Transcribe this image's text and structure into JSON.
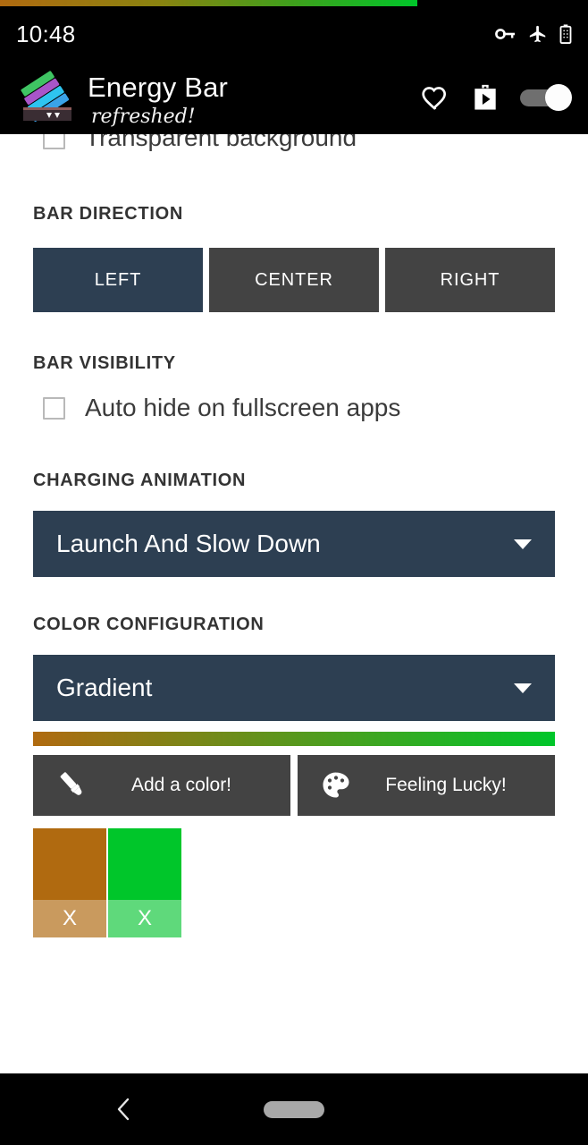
{
  "status_bar": {
    "time": "10:48",
    "icons": [
      "vpn-key-icon",
      "airplane-mode-icon",
      "battery-icon"
    ]
  },
  "app_header": {
    "logo": "energy-bar-logo",
    "title": "Energy Bar",
    "subtitle": "refreshed!",
    "actions": [
      {
        "name": "favorite-icon",
        "label": "heart"
      },
      {
        "name": "play-store-icon",
        "label": "store"
      },
      {
        "name": "master-toggle",
        "label": "on",
        "state": "on"
      }
    ]
  },
  "settings": {
    "transparent_background": {
      "label": "Transparent background",
      "checked": false
    },
    "bar_direction": {
      "title": "BAR DIRECTION",
      "options": [
        "LEFT",
        "CENTER",
        "RIGHT"
      ],
      "selected": "LEFT"
    },
    "bar_visibility": {
      "title": "BAR VISIBILITY",
      "auto_hide_label": "Auto hide on fullscreen apps",
      "auto_hide_checked": false
    },
    "charging_animation": {
      "title": "CHARGING ANIMATION",
      "selected": "Launch And Slow Down"
    },
    "color_configuration": {
      "title": "COLOR CONFIGURATION",
      "selected": "Gradient",
      "gradient_start": "#b06a10",
      "gradient_end": "#00c62a",
      "add_color_label": "Add a color!",
      "feeling_lucky_label": "Feeling Lucky!",
      "swatches": [
        {
          "color": "#b06a10",
          "remove_label": "X",
          "remove_bar_color": "#c99a5e"
        },
        {
          "color": "#00c62a",
          "remove_label": "X",
          "remove_bar_color": "#5fd97b"
        }
      ]
    }
  },
  "nav_bar": {
    "back": "back-chevron-icon",
    "home": "home-pill-icon"
  },
  "theme": {
    "accent_navy": "#2d3f52",
    "button_gray": "#434343",
    "page_bg": "#ffffff",
    "system_bg": "#000000"
  }
}
